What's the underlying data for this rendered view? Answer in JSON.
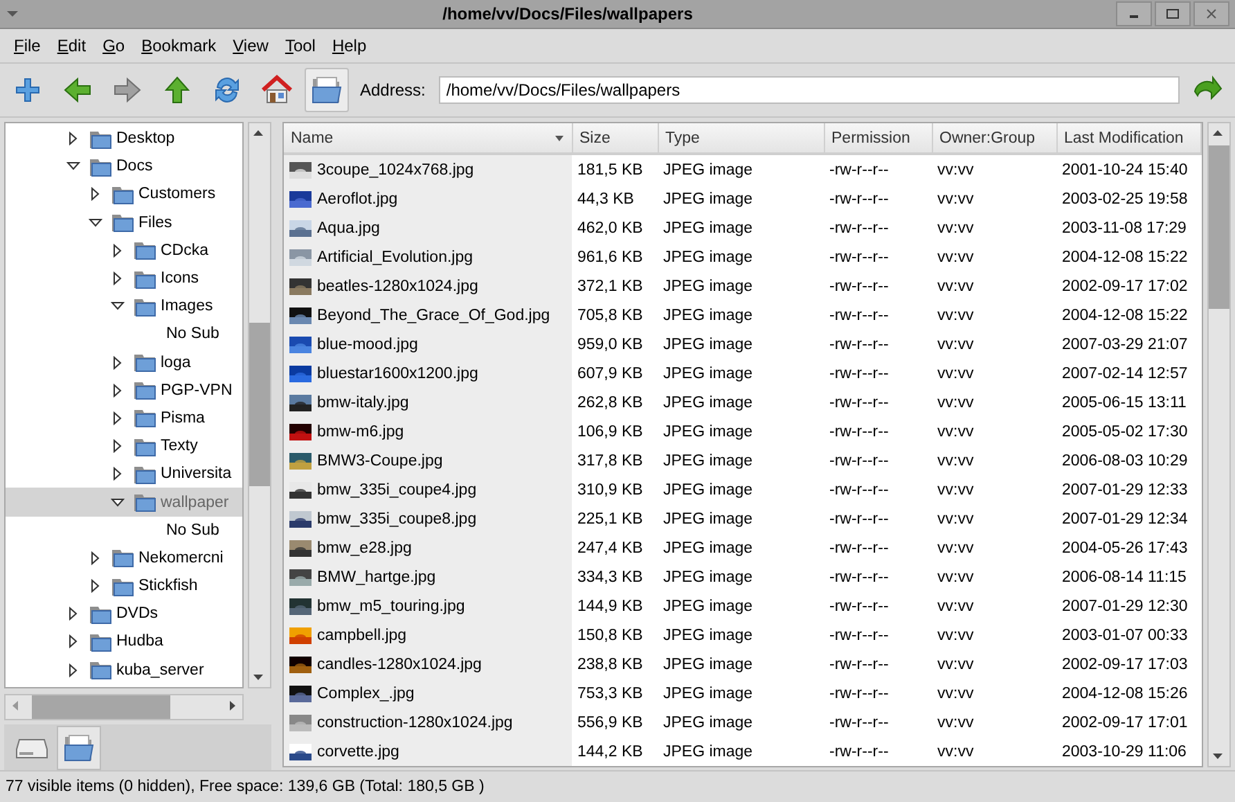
{
  "window": {
    "title": "/home/vv/Docs/Files/wallpapers"
  },
  "menu": [
    "File",
    "Edit",
    "Go",
    "Bookmark",
    "View",
    "Tool",
    "Help"
  ],
  "toolbar": {
    "address_label": "Address:",
    "address": "/home/vv/Docs/Files/wallpapers"
  },
  "tree": [
    {
      "label": "Desktop",
      "expanded": false,
      "selected": false
    },
    {
      "label": "Docs",
      "expanded": true,
      "selected": false,
      "children": [
        {
          "label": "Customers",
          "expanded": false,
          "selected": false
        },
        {
          "label": "Files",
          "expanded": true,
          "selected": false,
          "children": [
            {
              "label": "CDcka",
              "expanded": false,
              "selected": false
            },
            {
              "label": "Icons",
              "expanded": false,
              "selected": false
            },
            {
              "label": "Images",
              "expanded": true,
              "selected": false,
              "children": [
                {
                  "kind": "note",
                  "label": "No Sub"
                }
              ]
            },
            {
              "label": "loga",
              "expanded": false,
              "selected": false
            },
            {
              "label": "PGP-VPN",
              "expanded": false,
              "selected": false
            },
            {
              "label": "Pisma",
              "expanded": false,
              "selected": false
            },
            {
              "label": "Texty",
              "expanded": false,
              "selected": false
            },
            {
              "label": "Universita",
              "expanded": false,
              "selected": false
            },
            {
              "label": "wallpaper",
              "expanded": true,
              "selected": true,
              "children": [
                {
                  "kind": "note",
                  "label": "No Sub"
                }
              ]
            }
          ]
        },
        {
          "label": "Nekomercni",
          "expanded": false,
          "selected": false
        },
        {
          "label": "Stickfish",
          "expanded": false,
          "selected": false
        }
      ]
    },
    {
      "label": "DVDs",
      "expanded": false,
      "selected": false
    },
    {
      "label": "Hudba",
      "expanded": false,
      "selected": false
    },
    {
      "label": "kuba_server",
      "expanded": false,
      "selected": false
    }
  ],
  "side_tabs": [
    {
      "kind": "drive",
      "selected": false
    },
    {
      "kind": "folder",
      "selected": true
    }
  ],
  "table": {
    "columns": [
      "Name",
      "Size",
      "Type",
      "Permission",
      "Owner:Group",
      "Last Modification"
    ],
    "rows": [
      [
        "3coupe_1024x768.jpg",
        "181,5 KB",
        "JPEG image",
        "-rw-r--r--",
        "vv:vv",
        "2001-10-24 15:40"
      ],
      [
        "Aeroflot.jpg",
        "44,3 KB",
        "JPEG image",
        "-rw-r--r--",
        "vv:vv",
        "2003-02-25 19:58"
      ],
      [
        "Aqua.jpg",
        "462,0 KB",
        "JPEG image",
        "-rw-r--r--",
        "vv:vv",
        "2003-11-08 17:29"
      ],
      [
        "Artificial_Evolution.jpg",
        "961,6 KB",
        "JPEG image",
        "-rw-r--r--",
        "vv:vv",
        "2004-12-08 15:22"
      ],
      [
        "beatles-1280x1024.jpg",
        "372,1 KB",
        "JPEG image",
        "-rw-r--r--",
        "vv:vv",
        "2002-09-17 17:02"
      ],
      [
        "Beyond_The_Grace_Of_God.jpg",
        "705,8 KB",
        "JPEG image",
        "-rw-r--r--",
        "vv:vv",
        "2004-12-08 15:22"
      ],
      [
        "blue-mood.jpg",
        "959,0 KB",
        "JPEG image",
        "-rw-r--r--",
        "vv:vv",
        "2007-03-29 21:07"
      ],
      [
        "bluestar1600x1200.jpg",
        "607,9 KB",
        "JPEG image",
        "-rw-r--r--",
        "vv:vv",
        "2007-02-14 12:57"
      ],
      [
        "bmw-italy.jpg",
        "262,8 KB",
        "JPEG image",
        "-rw-r--r--",
        "vv:vv",
        "2005-06-15 13:11"
      ],
      [
        "bmw-m6.jpg",
        "106,9 KB",
        "JPEG image",
        "-rw-r--r--",
        "vv:vv",
        "2005-05-02 17:30"
      ],
      [
        "BMW3-Coupe.jpg",
        "317,8 KB",
        "JPEG image",
        "-rw-r--r--",
        "vv:vv",
        "2006-08-03 10:29"
      ],
      [
        "bmw_335i_coupe4.jpg",
        "310,9 KB",
        "JPEG image",
        "-rw-r--r--",
        "vv:vv",
        "2007-01-29 12:33"
      ],
      [
        "bmw_335i_coupe8.jpg",
        "225,1 KB",
        "JPEG image",
        "-rw-r--r--",
        "vv:vv",
        "2007-01-29 12:34"
      ],
      [
        "bmw_e28.jpg",
        "247,4 KB",
        "JPEG image",
        "-rw-r--r--",
        "vv:vv",
        "2004-05-26 17:43"
      ],
      [
        "BMW_hartge.jpg",
        "334,3 KB",
        "JPEG image",
        "-rw-r--r--",
        "vv:vv",
        "2006-08-14 11:15"
      ],
      [
        "bmw_m5_touring.jpg",
        "144,9 KB",
        "JPEG image",
        "-rw-r--r--",
        "vv:vv",
        "2007-01-29 12:30"
      ],
      [
        "campbell.jpg",
        "150,8 KB",
        "JPEG image",
        "-rw-r--r--",
        "vv:vv",
        "2003-01-07 00:33"
      ],
      [
        "candles-1280x1024.jpg",
        "238,8 KB",
        "JPEG image",
        "-rw-r--r--",
        "vv:vv",
        "2002-09-17 17:03"
      ],
      [
        "Complex_.jpg",
        "753,3 KB",
        "JPEG image",
        "-rw-r--r--",
        "vv:vv",
        "2004-12-08 15:26"
      ],
      [
        "construction-1280x1024.jpg",
        "556,9 KB",
        "JPEG image",
        "-rw-r--r--",
        "vv:vv",
        "2002-09-17 17:01"
      ],
      [
        "corvette.jpg",
        "144,2 KB",
        "JPEG image",
        "-rw-r--r--",
        "vv:vv",
        "2003-10-29 11:06"
      ]
    ]
  },
  "status_bar": "77 visible items (0 hidden), Free space: 139,6 GB (Total: 180,5 GB )"
}
